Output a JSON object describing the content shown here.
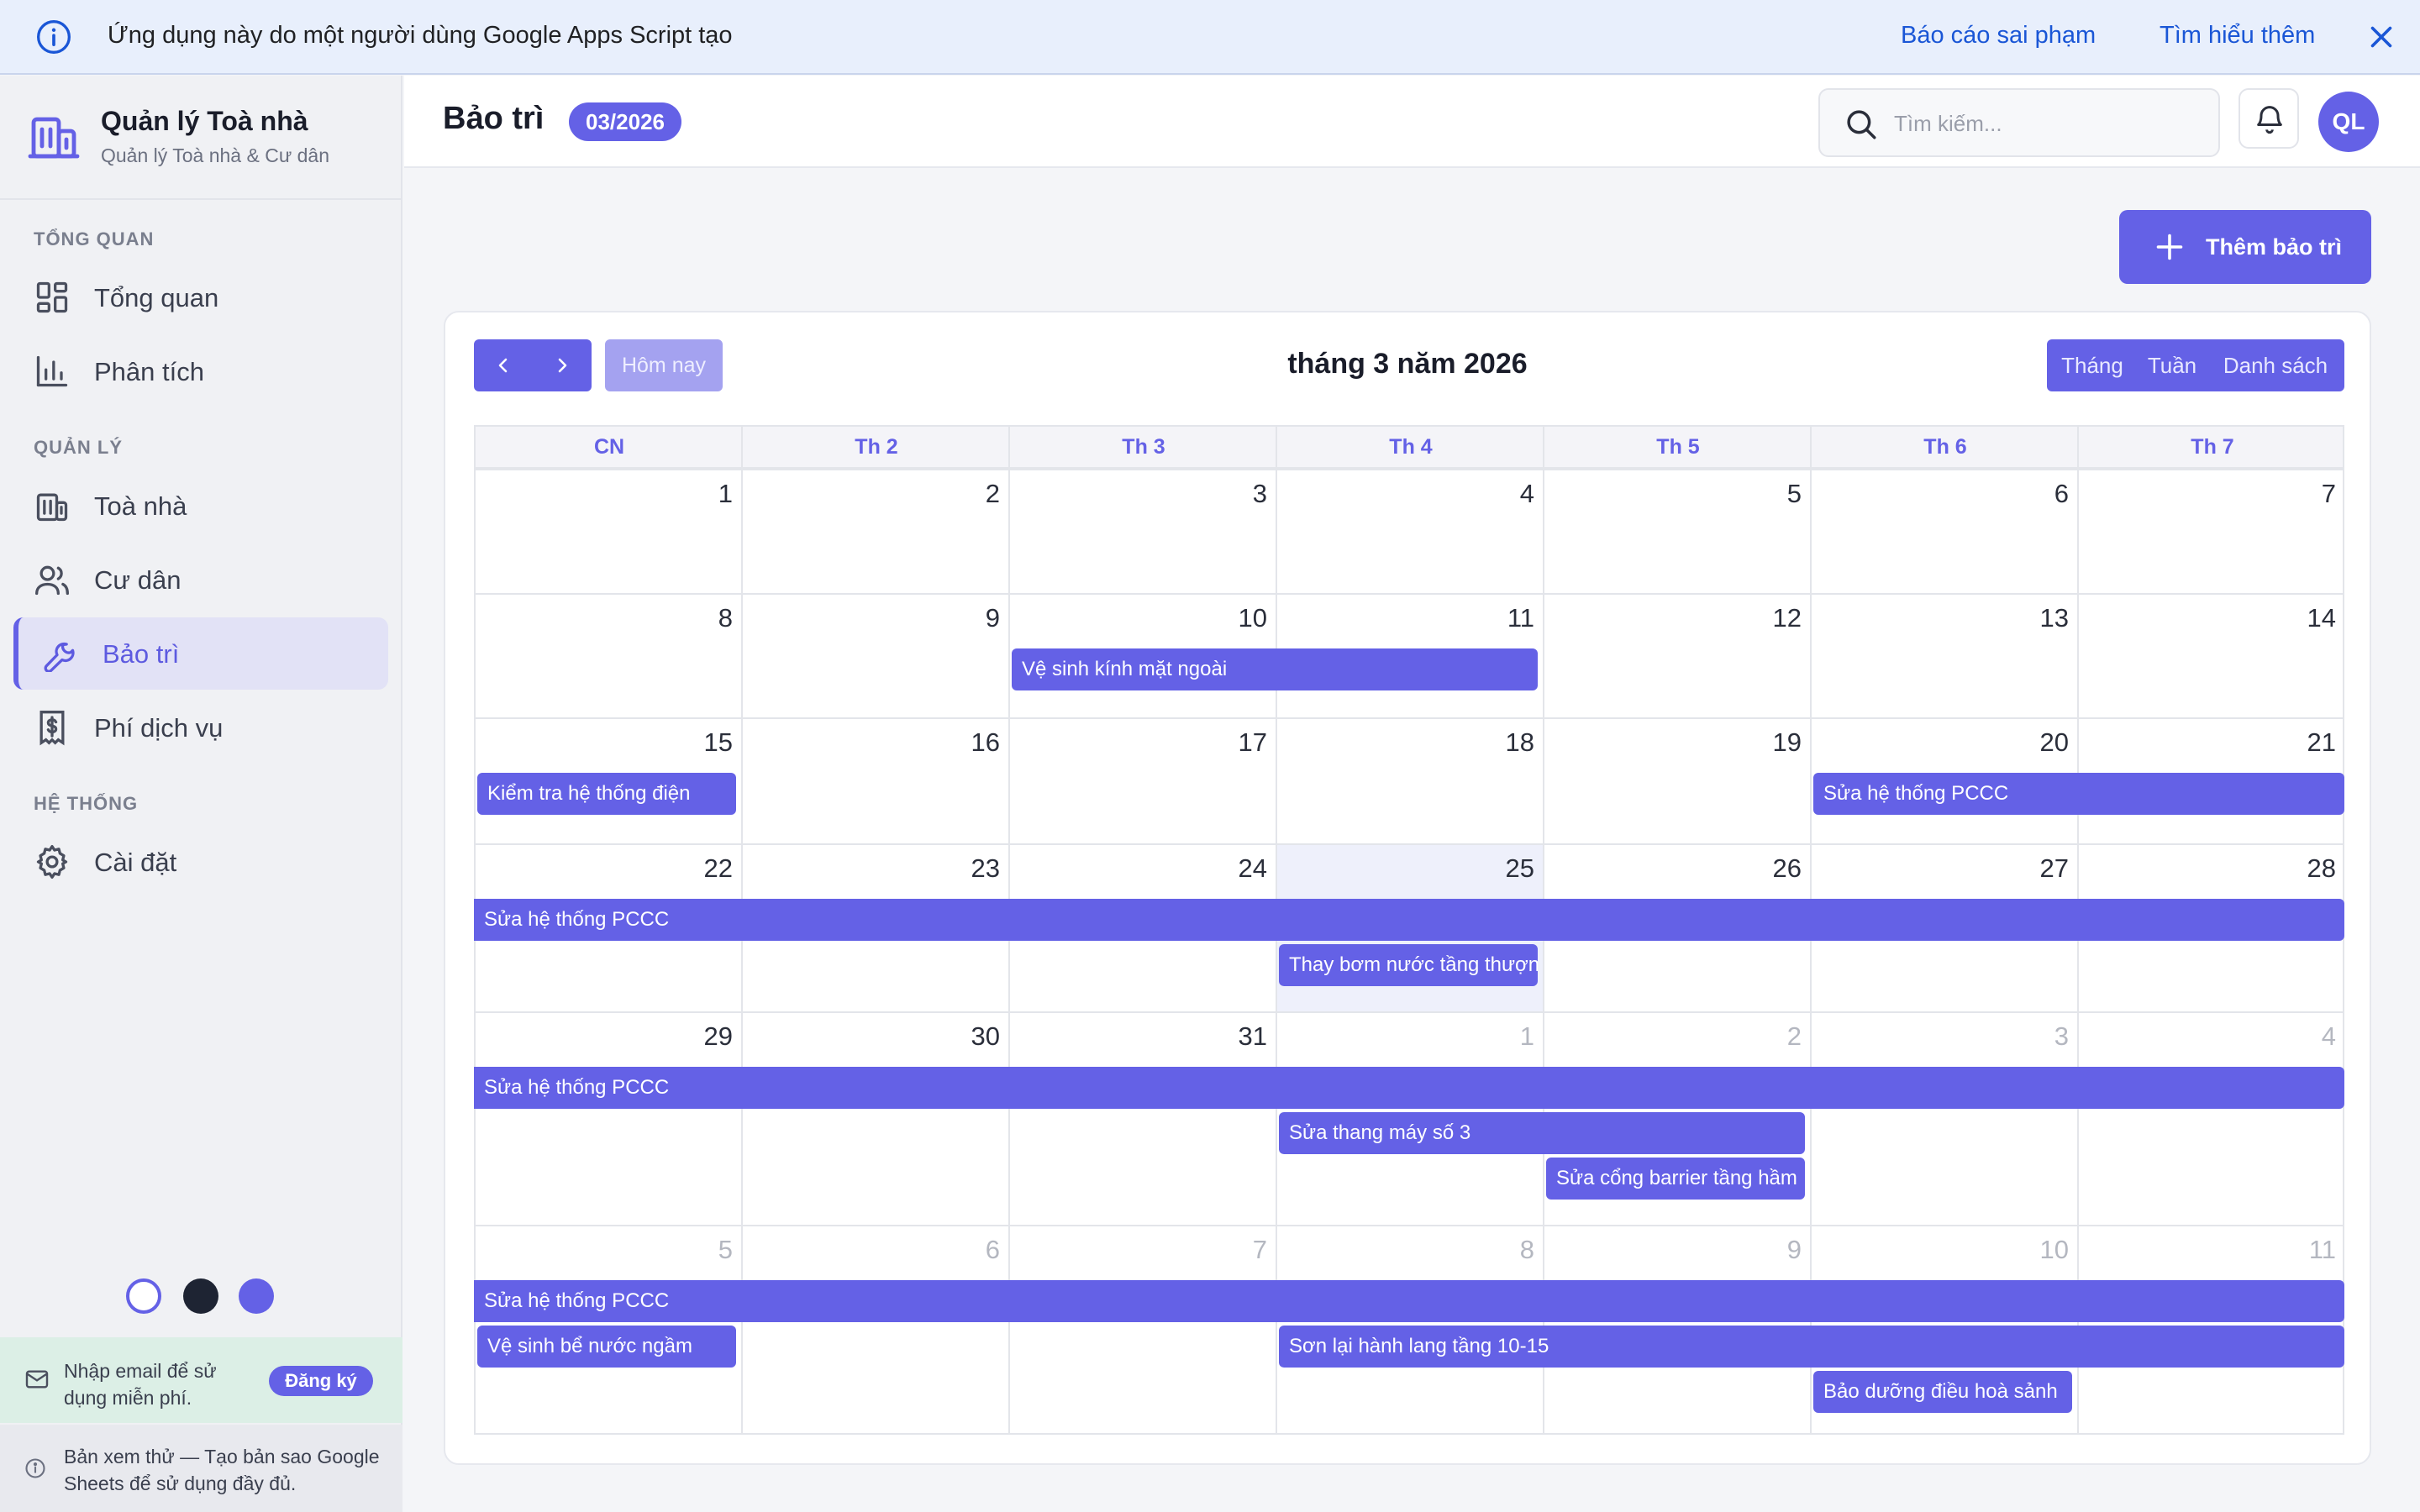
{
  "banner": {
    "text": "Ứng dụng này do một người dùng Google Apps Script tạo",
    "report_link": "Báo cáo sai phạm",
    "learn_more_link": "Tìm hiểu thêm"
  },
  "brand": {
    "name": "Quản lý Toà nhà",
    "subtitle": "Quản lý Toà nhà & Cư dân"
  },
  "sidebar": {
    "sections": {
      "overview": "TỔNG QUAN",
      "manage": "QUẢN LÝ",
      "system": "HỆ THỐNG"
    },
    "items": [
      {
        "label": "Tổng quan",
        "icon": "grid-icon"
      },
      {
        "label": "Phân tích",
        "icon": "bar-chart-icon"
      },
      {
        "label": "Toà nhà",
        "icon": "building-icon"
      },
      {
        "label": "Cư dân",
        "icon": "users-icon"
      },
      {
        "label": "Bảo trì",
        "icon": "wrench-icon",
        "active": true
      },
      {
        "label": "Phí dịch vụ",
        "icon": "receipt-icon"
      },
      {
        "label": "Cài đặt",
        "icon": "gear-icon"
      }
    ],
    "theme_colors": [
      "#ffffff",
      "#1e2433",
      "#6461e6"
    ],
    "signup": {
      "text": "Nhập email để sử dụng miễn phí.",
      "button": "Đăng ký"
    },
    "trial": {
      "text": "Bản xem thử — Tạo bản sao Google Sheets để sử dụng đầy đủ."
    }
  },
  "header": {
    "title": "Bảo trì",
    "period": "03/2026",
    "search_placeholder": "Tìm kiếm...",
    "avatar_initials": "QL"
  },
  "main": {
    "add_button": "Thêm bảo trì"
  },
  "calendar": {
    "title": "tháng 3 năm 2026",
    "today_button": "Hôm nay",
    "views": [
      "Tháng",
      "Tuần",
      "Danh sách"
    ],
    "weekdays": [
      "CN",
      "Th 2",
      "Th 3",
      "Th 4",
      "Th 5",
      "Th 6",
      "Th 7"
    ],
    "weeks": [
      [
        "1",
        "2",
        "3",
        "4",
        "5",
        "6",
        "7"
      ],
      [
        "8",
        "9",
        "10",
        "11",
        "12",
        "13",
        "14"
      ],
      [
        "15",
        "16",
        "17",
        "18",
        "19",
        "20",
        "21"
      ],
      [
        "22",
        "23",
        "24",
        "25",
        "26",
        "27",
        "28"
      ],
      [
        "29",
        "30",
        "31",
        "1",
        "2",
        "3",
        "4"
      ],
      [
        "5",
        "6",
        "7",
        "8",
        "9",
        "10",
        "11"
      ]
    ],
    "today": "2026-03-25",
    "events": [
      {
        "title": "Vệ sinh kính mặt ngoài",
        "start": "2026-03-10",
        "end": "2026-03-11"
      },
      {
        "title": "Kiểm tra hệ thống điện",
        "start": "2026-03-15",
        "end": "2026-03-15"
      },
      {
        "title": "Sửa hệ thống PCCC",
        "start": "2026-03-20",
        "end": "2026-04-11"
      },
      {
        "title": "Thay bơm nước tầng thượng",
        "start": "2026-03-25",
        "end": "2026-03-25"
      },
      {
        "title": "Sửa thang máy số 3",
        "start": "2026-04-01",
        "end": "2026-04-02"
      },
      {
        "title": "Sửa cổng barrier tầng hầm",
        "start": "2026-04-02",
        "end": "2026-04-02"
      },
      {
        "title": "Vệ sinh bể nước ngầm",
        "start": "2026-04-05",
        "end": "2026-04-05"
      },
      {
        "title": "Sơn lại hành lang tầng 10-15",
        "start": "2026-04-08",
        "end": "2026-04-11"
      },
      {
        "title": "Bảo dưỡng điều hoà sảnh",
        "start": "2026-04-10",
        "end": "2026-04-10"
      }
    ]
  },
  "colors": {
    "accent": "#6461e6",
    "banner_bg": "#e8effc",
    "link": "#1a56d6"
  }
}
